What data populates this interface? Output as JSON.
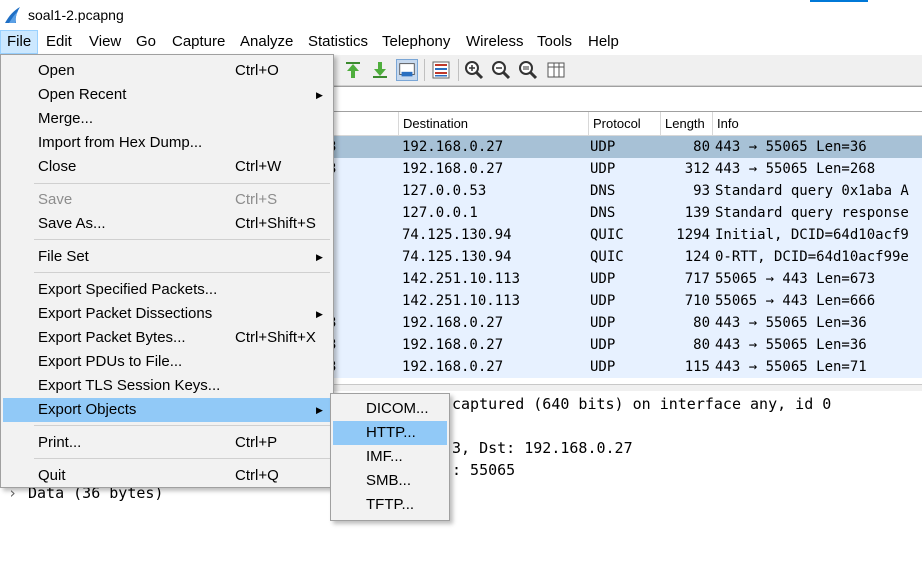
{
  "window": {
    "title": "soal1-2.pcapng",
    "app_icon": "wireshark-fin-icon"
  },
  "menubar": [
    "File",
    "Edit",
    "View",
    "Go",
    "Capture",
    "Analyze",
    "Statistics",
    "Telephony",
    "Wireless",
    "Tools",
    "Help"
  ],
  "packet_list": {
    "columns": [
      "Destination",
      "Protocol",
      "Length",
      "Info"
    ],
    "rows": [
      {
        "src_tail": "3",
        "dst": "192.168.0.27",
        "proto": "UDP",
        "len": "80",
        "info": "443 → 55065 Len=36"
      },
      {
        "src_tail": "3",
        "dst": "192.168.0.27",
        "proto": "UDP",
        "len": "312",
        "info": "443 → 55065 Len=268"
      },
      {
        "src_tail": "",
        "dst": "127.0.0.53",
        "proto": "DNS",
        "len": "93",
        "info": "Standard query 0x1aba A"
      },
      {
        "src_tail": "",
        "dst": "127.0.0.1",
        "proto": "DNS",
        "len": "139",
        "info": "Standard query response"
      },
      {
        "src_tail": "",
        "dst": "74.125.130.94",
        "proto": "QUIC",
        "len": "1294",
        "info": "Initial, DCID=64d10acf9"
      },
      {
        "src_tail": "",
        "dst": "74.125.130.94",
        "proto": "QUIC",
        "len": "124",
        "info": "0-RTT, DCID=64d10acf99e"
      },
      {
        "src_tail": "",
        "dst": "142.251.10.113",
        "proto": "UDP",
        "len": "717",
        "info": "55065 → 443 Len=673"
      },
      {
        "src_tail": "",
        "dst": "142.251.10.113",
        "proto": "UDP",
        "len": "710",
        "info": "55065 → 443 Len=666"
      },
      {
        "src_tail": "3",
        "dst": "192.168.0.27",
        "proto": "UDP",
        "len": "80",
        "info": "443 → 55065 Len=36"
      },
      {
        "src_tail": "3",
        "dst": "192.168.0.27",
        "proto": "UDP",
        "len": "80",
        "info": "443 → 55065 Len=36"
      },
      {
        "src_tail": "3",
        "dst": "192.168.0.27",
        "proto": "UDP",
        "len": "115",
        "info": "443 → 55065 Len=71"
      }
    ]
  },
  "details": {
    "line1": "captured (640 bits) on interface any, id 0",
    "line2": "3, Dst: 192.168.0.27",
    "line3": ": 55065",
    "line4": "Data (36 bytes)"
  },
  "file_menu": {
    "items": [
      {
        "label": "Open",
        "shortcut": "Ctrl+O"
      },
      {
        "label": "Open Recent",
        "submenu": true
      },
      {
        "label": "Merge..."
      },
      {
        "label": "Import from Hex Dump..."
      },
      {
        "label": "Close",
        "shortcut": "Ctrl+W"
      },
      {
        "label": "Save",
        "shortcut": "Ctrl+S",
        "disabled": true
      },
      {
        "label": "Save As...",
        "shortcut": "Ctrl+Shift+S"
      },
      {
        "label": "File Set",
        "submenu": true
      },
      {
        "label": "Export Specified Packets..."
      },
      {
        "label": "Export Packet Dissections",
        "submenu": true
      },
      {
        "label": "Export Packet Bytes...",
        "shortcut": "Ctrl+Shift+X"
      },
      {
        "label": "Export PDUs to File..."
      },
      {
        "label": "Export TLS Session Keys..."
      },
      {
        "label": "Export Objects",
        "submenu": true,
        "highlighted": true
      },
      {
        "label": "Print...",
        "shortcut": "Ctrl+P"
      },
      {
        "label": "Quit",
        "shortcut": "Ctrl+Q"
      }
    ]
  },
  "export_objects_submenu": [
    "DICOM...",
    "HTTP...",
    "IMF...",
    "SMB...",
    "TFTP..."
  ],
  "colors": {
    "row_bg": "#e7f1ff",
    "row_selected": "#a7c1d6",
    "menu_highlight": "#91c9f7"
  }
}
